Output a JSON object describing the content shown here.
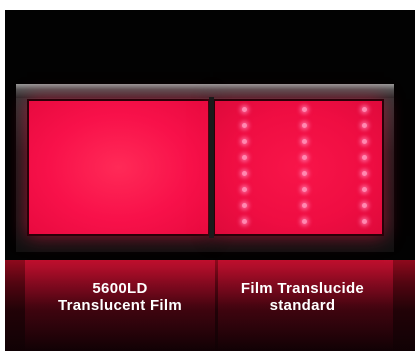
{
  "labels": {
    "left": {
      "line1": "5600LD",
      "line2": "Translucent Film"
    },
    "right": {
      "line1": "Film Translucide",
      "line2": "standard"
    }
  },
  "colors": {
    "background": "#020202",
    "panel_glow": "#f8114a",
    "led_dot": "#ff88b0",
    "label_text": "#ffffff"
  }
}
